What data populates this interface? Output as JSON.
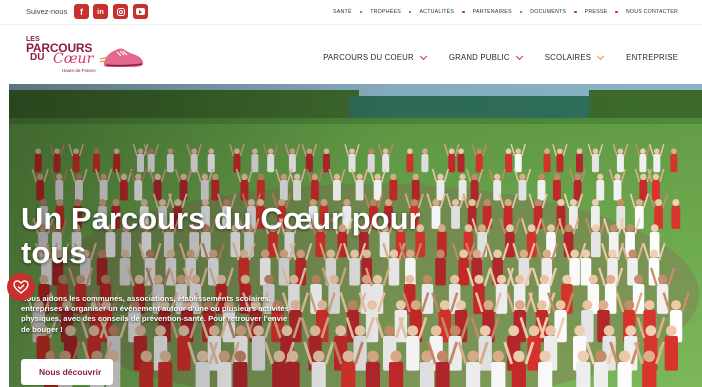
{
  "topbar": {
    "follow_label": "Suivez-nous",
    "social": [
      {
        "name": "facebook-icon",
        "glyph": "f"
      },
      {
        "name": "linkedin-icon",
        "glyph": "in"
      },
      {
        "name": "instagram-icon",
        "glyph": ""
      },
      {
        "name": "youtube-icon",
        "glyph": ""
      }
    ],
    "links": [
      "SANTÉ",
      "TROPHÉES",
      "ACTUALITÉS",
      "PARTENAIRES",
      "DOCUMENTS",
      "PRESSE",
      "NOUS CONTACTER"
    ]
  },
  "logo": {
    "line1": "LES",
    "line2": "PARCOURS",
    "line3": "DU",
    "line4": "Cœur",
    "region": "Hauts-de-France"
  },
  "nav": {
    "items": [
      {
        "label": "PARCOURS DU COEUR",
        "has_dropdown": true,
        "chevron_color": "red"
      },
      {
        "label": "GRAND PUBLIC",
        "has_dropdown": true,
        "chevron_color": "red"
      },
      {
        "label": "SCOLAIRES",
        "has_dropdown": true,
        "chevron_color": "orange"
      },
      {
        "label": "ENTREPRISE",
        "has_dropdown": false
      }
    ]
  },
  "hero": {
    "title": "Un Parcours du Cœur pour tous",
    "description": "Nous aidons les communes, associations, établissements scolaires, entreprises à organiser un événement autour d'une ou plusieurs activités physiques, avec des conseils de prévention-santé. Pour retrouver l'envie de bouger !",
    "cta_label": "Nous découvrir",
    "badge_icon": "heart-check-icon"
  },
  "colors": {
    "brand_red": "#c7302c",
    "brand_burgundy": "#8a1e3c",
    "accent_orange": "#e39037",
    "grass_green": "#6aa84f"
  }
}
